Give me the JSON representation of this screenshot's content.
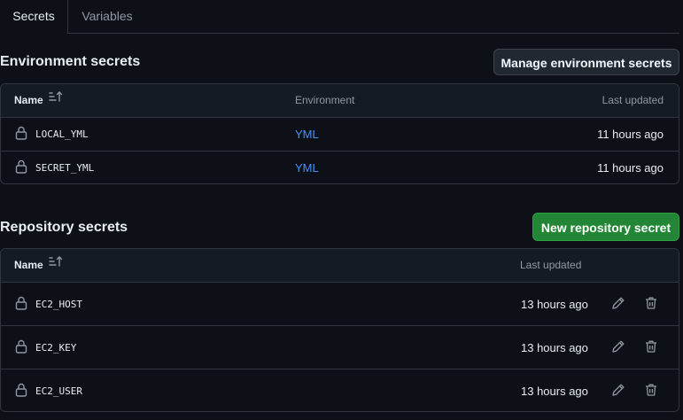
{
  "tabs": [
    {
      "label": "Secrets",
      "active": true
    },
    {
      "label": "Variables",
      "active": false
    }
  ],
  "environment": {
    "title": "Environment secrets",
    "manage_button": "Manage environment secrets",
    "columns": {
      "name": "Name",
      "environment": "Environment",
      "last_updated": "Last updated"
    },
    "rows": [
      {
        "name": "LOCAL_YML",
        "environment": "YML",
        "updated": "11 hours ago"
      },
      {
        "name": "SECRET_YML",
        "environment": "YML",
        "updated": "11 hours ago"
      }
    ]
  },
  "repository": {
    "title": "Repository secrets",
    "new_button": "New repository secret",
    "columns": {
      "name": "Name",
      "last_updated": "Last updated"
    },
    "rows": [
      {
        "name": "EC2_HOST",
        "updated": "13 hours ago"
      },
      {
        "name": "EC2_KEY",
        "updated": "13 hours ago"
      },
      {
        "name": "EC2_USER",
        "updated": "13 hours ago"
      }
    ]
  },
  "icons": {
    "lock": "lock-icon",
    "sort": "sort-icon",
    "edit": "pencil-icon",
    "delete": "trash-icon"
  },
  "colors": {
    "background": "#0d1117",
    "primary_button": "#238636",
    "link": "#4493f8",
    "border": "#30363d"
  }
}
